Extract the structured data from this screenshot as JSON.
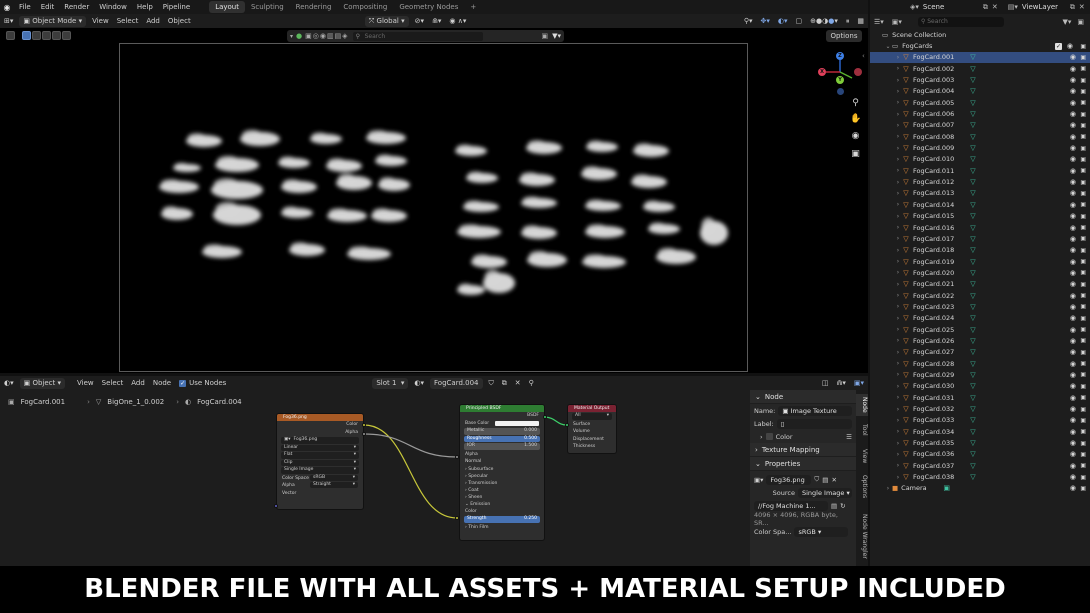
{
  "top_menu": {
    "items": [
      "File",
      "Edit",
      "Render",
      "Window",
      "Help",
      "Pipeline"
    ],
    "workspaces": [
      "Layout",
      "Sculpting",
      "Rendering",
      "Compositing",
      "Geometry Nodes"
    ],
    "active_workspace": "Layout",
    "add_tab": "+"
  },
  "viewport_header": {
    "mode": "Object Mode",
    "menus": [
      "View",
      "Select",
      "Add",
      "Object"
    ],
    "orientation": "Global"
  },
  "viewport": {
    "search_placeholder": "Search",
    "options_label": "Options",
    "gizmo": {
      "x": "X",
      "y": "Y",
      "z": "Z"
    }
  },
  "node_editor": {
    "mode": "Object",
    "menus": [
      "View",
      "Select",
      "Add",
      "Node"
    ],
    "use_nodes_label": "Use Nodes",
    "slot": "Slot 1",
    "material": "FogCard.004",
    "breadcrumb": [
      "FogCard.001",
      "BigOne_1_0.002",
      "FogCard.004"
    ],
    "nodes": {
      "image_texture": {
        "title": "Fog36.png",
        "outputs": [
          "Color",
          "Alpha"
        ],
        "image": "Fog36.png",
        "interpolation": "Linear",
        "projection": "Flat",
        "extension": "Clip",
        "source": "Single Image",
        "color_space_label": "Color Space",
        "color_space": "sRGB",
        "alpha_label": "Alpha",
        "alpha": "Straight",
        "vector": "Vector"
      },
      "principled": {
        "title": "Principled BSDF",
        "output": "BSDF",
        "base_color": "Base Color",
        "metallic_label": "Metallic",
        "metallic": "0.000",
        "roughness_label": "Roughness",
        "roughness": "0.500",
        "ior_label": "IOR",
        "ior": "1.500",
        "alpha": "Alpha",
        "normal": "Normal",
        "panels": [
          "Subsurface",
          "Specular",
          "Transmission",
          "Coat",
          "Sheen",
          "Emission"
        ],
        "color": "Color",
        "strength_label": "Strength",
        "strength": "0.250",
        "thin_film": "Thin Film"
      },
      "material_output": {
        "title": "Material Output",
        "target": "All",
        "inputs": [
          "Surface",
          "Volume",
          "Displacement",
          "Thickness"
        ]
      }
    }
  },
  "side_panel": {
    "tabs": [
      "Node",
      "Tool",
      "View",
      "Options",
      "Node Wrangler"
    ],
    "node_section": "Node",
    "name_label": "Name:",
    "name_value": "Image Texture",
    "label_label": "Label:",
    "color_label": "Color",
    "texture_mapping": "Texture Mapping",
    "properties": "Properties",
    "image_name": "Fog36.png",
    "source_label": "Source",
    "source_value": "Single Image",
    "filepath": "//Fog Machine 1...",
    "image_info": "4096 × 4096,  RGBA byte, SR...",
    "color_space_label": "Color Spa...",
    "color_space_value": "sRGB"
  },
  "outliner": {
    "scene_label": "Scene",
    "viewlayer_label": "ViewLayer",
    "search_placeholder": "Search",
    "root": "Scene Collection",
    "collection": "FogCards",
    "items": [
      "FogCard.001",
      "FogCard.002",
      "FogCard.003",
      "FogCard.004",
      "FogCard.005",
      "FogCard.006",
      "FogCard.007",
      "FogCard.008",
      "FogCard.009",
      "FogCard.010",
      "FogCard.011",
      "FogCard.012",
      "FogCard.013",
      "FogCard.014",
      "FogCard.015",
      "FogCard.016",
      "FogCard.017",
      "FogCard.018",
      "FogCard.019",
      "FogCard.020",
      "FogCard.021",
      "FogCard.022",
      "FogCard.023",
      "FogCard.024",
      "FogCard.025",
      "FogCard.026",
      "FogCard.027",
      "FogCard.028",
      "FogCard.029",
      "FogCard.030",
      "FogCard.031",
      "FogCard.032",
      "FogCard.033",
      "FogCard.034",
      "FogCard.035",
      "FogCard.036",
      "FogCard.037",
      "FogCard.038"
    ],
    "selected_item": "FogCard.001",
    "camera": "Camera"
  },
  "banner": {
    "text": "BLENDER FILE WITH ALL ASSETS + MATERIAL SETUP INCLUDED"
  },
  "colors": {
    "accent": "#4772b3",
    "selected_row": "#334d80",
    "object_orange": "#e08a3c",
    "material_teal": "#3fc2a1",
    "image_node_header": "#a85a25",
    "shader_node_header": "#2e7d32",
    "output_node_header": "#7a2232"
  }
}
